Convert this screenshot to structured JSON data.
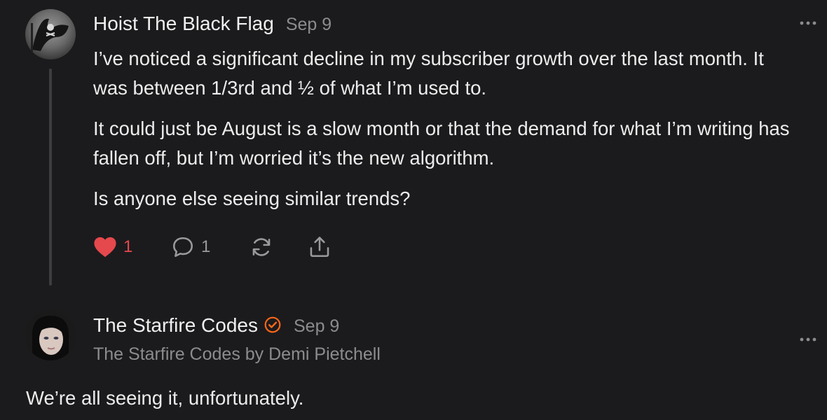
{
  "comments": [
    {
      "author": "Hoist The Black Flag",
      "date": "Sep 9",
      "avatar_icon": "pirate-flag-icon",
      "paragraphs": [
        "I’ve noticed a significant decline in my subscriber growth over the last month. It was between 1/3rd and ½ of what I’m used to.",
        "It could just be August is a slow month or that the demand for what I’m writing has fallen off, but I’m worried it’s the new algorithm.",
        "Is anyone else seeing similar trends?"
      ],
      "actions": {
        "like_count": "1",
        "liked": true,
        "reply_count": "1",
        "restack_icon": "restack-icon",
        "share_icon": "share-icon"
      }
    },
    {
      "author": "The Starfire Codes",
      "verified": true,
      "date": "Sep 9",
      "publication": "The Starfire Codes by Demi Pietchell",
      "avatar_icon": "user-photo-avatar",
      "text": "We’re all seeing it, unfortunately."
    }
  ],
  "colors": {
    "background": "#1b1b1d",
    "like_red": "#e5484d",
    "verified_orange": "#ff6719",
    "muted_text": "#8c8c8f"
  }
}
